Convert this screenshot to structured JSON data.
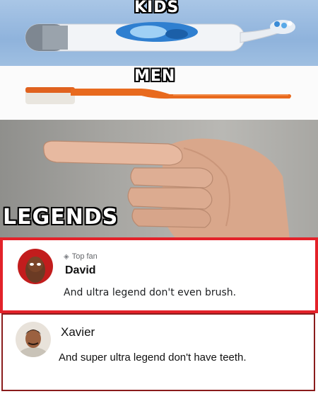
{
  "panels": {
    "kids_label": "KIDS",
    "men_label": "MEN",
    "legends_label": "LEGENDS"
  },
  "comments": [
    {
      "badge": "Top fan",
      "badge_icon": "diamond-icon",
      "name": "David",
      "text": "And ultra legend don't even brush.",
      "border_color": "#e3222a"
    },
    {
      "name": "Xavier",
      "text": "And super ultra legend don't have teeth.",
      "border_color": "#8a1c1c"
    }
  ]
}
